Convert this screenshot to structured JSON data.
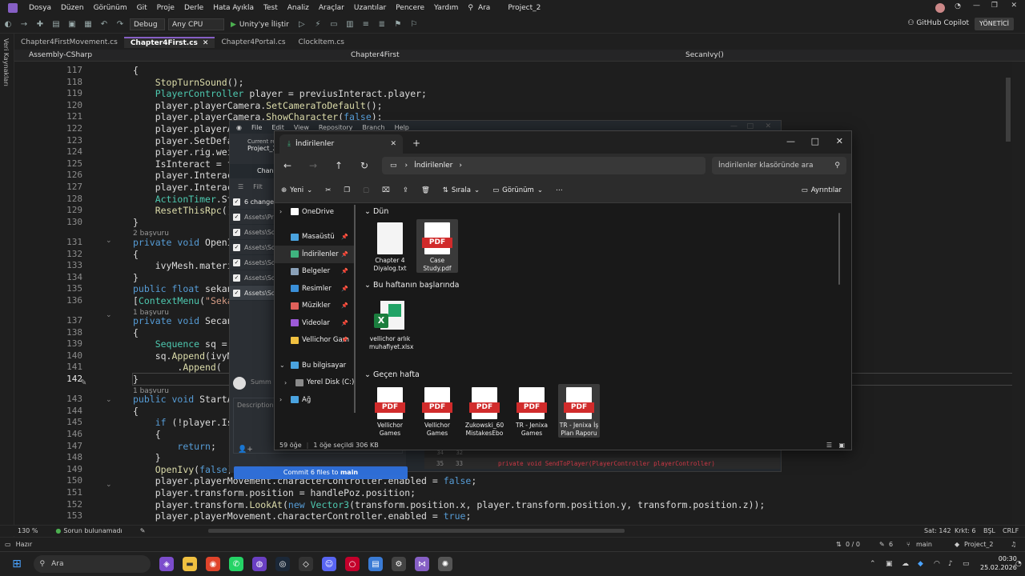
{
  "menu": {
    "items": [
      "Dosya",
      "Düzen",
      "Görünüm",
      "Git",
      "Proje",
      "Derle",
      "Hata Ayıkla",
      "Test",
      "Analiz",
      "Araçlar",
      "Uzantılar",
      "Pencere",
      "Yardım",
      "Ara",
      "Project_2"
    ]
  },
  "toolbar": {
    "config": "Debug",
    "platform": "Any CPU",
    "run_label": "Unity'ye İliştir",
    "copilot": "GitHub Copilot",
    "admin": "YÖNETİCİ"
  },
  "side": {
    "label": "Veri Kaynakları"
  },
  "tabs": [
    {
      "label": "Chapter4FirstMovement.cs",
      "active": false
    },
    {
      "label": "Chapter4First.cs",
      "active": true
    },
    {
      "label": "Chapter4Portal.cs",
      "active": false
    },
    {
      "label": "ClockItem.cs",
      "active": false
    }
  ],
  "navbar": {
    "project": "Assembly-CSharp",
    "class": "Chapter4First",
    "member": "SecanIvy()"
  },
  "code": {
    "line_numbers": [
      "117",
      "118",
      "119",
      "120",
      "121",
      "122",
      "123",
      "124",
      "125",
      "126",
      "127",
      "128",
      "129",
      "130",
      "131",
      "132",
      "133",
      "134",
      "135",
      "136",
      "137",
      "138",
      "139",
      "140",
      "141",
      "142",
      "143",
      "144",
      "145",
      "146",
      "147",
      "148",
      "149",
      "150",
      "151",
      "152",
      "153"
    ],
    "current_line": "142",
    "hint_2": "2 başvuru",
    "hint_1": "1 başvuru",
    "lines": [
      "{",
      "    StopTurnSound();",
      "    PlayerController player = previusInteract.player;",
      "    player.playerCamera.SetCameraToDefault();",
      "    player.playerCamera.ShowCharacter(false);",
      "    player.playerA",
      "    player.SetDefa",
      "    player.rig.wei",
      "    IsInteract = f",
      "    player.Interac",
      "    player.Interac",
      "    ActionTimer.St",
      "    ResetThisRpc()",
      "}",
      "private void OpenI",
      "{",
      "    ivyMesh.materi",
      "}",
      "public float sekan",
      "[ContextMenu(\"Seka",
      "private void Secan",
      "{",
      "    Sequence sq = ",
      "    sq.Append(ivyM",
      "        .Append(",
      "}",
      "public void StartA",
      "{",
      "    if (!player.Is",
      "    {",
      "        return;",
      "    }",
      "    OpenIvy(false);",
      "    player.playerMovement.characterController.enabled = false;",
      "    player.transform.position = handlePoz.position;",
      "    player.transform.LookAt(new Vector3(transform.position.x, player.transform.position.y, transform.position.z));",
      "    player.playerMovement.characterController.enabled = true;"
    ]
  },
  "github": {
    "menu": [
      "File",
      "Edit",
      "View",
      "Repository",
      "Branch",
      "Help"
    ],
    "current_repo_label": "Current re",
    "repo": "Project_2",
    "changes_tab": "Chan",
    "filter": "Filt",
    "changed_count": "6 changed",
    "files": [
      "Assets\\Pr",
      "Assets\\Sc",
      "Assets\\Sc",
      "Assets\\Sc",
      "Assets\\Sc",
      "Assets\\Sc"
    ],
    "summary": "Summ",
    "description": "Description",
    "commit_prefix": "Commit 6 files to ",
    "commit_branch": "main",
    "diff_old": "35",
    "diff_new": "33",
    "diff_prev_old": "34",
    "diff_prev_new": "32",
    "diff_code": "private void SendToPlayer(PlayerController playerController)"
  },
  "explorer": {
    "tab_title": "İndirilenler",
    "address": "İndirilenler",
    "search_placeholder": "İndirilenler klasöründe ara",
    "cmd": {
      "new": "Yeni",
      "sort": "Sırala",
      "view": "Görünüm",
      "details": "Ayrıntılar"
    },
    "nav": [
      {
        "label": "OneDrive",
        "pin": false,
        "color": "#ffffff",
        "caret": "›"
      },
      {
        "label": "Masaüstü",
        "pin": true,
        "color": "#4aa3df",
        "caret": ""
      },
      {
        "label": "İndirilenler",
        "pin": true,
        "color": "#3fb37f",
        "caret": "",
        "selected": true
      },
      {
        "label": "Belgeler",
        "pin": true,
        "color": "#8aa1b8",
        "caret": ""
      },
      {
        "label": "Resimler",
        "pin": true,
        "color": "#3a8fd8",
        "caret": ""
      },
      {
        "label": "Müzikler",
        "pin": true,
        "color": "#e0605a",
        "caret": ""
      },
      {
        "label": "Videolar",
        "pin": true,
        "color": "#9d5ad8",
        "caret": ""
      },
      {
        "label": "Vellichor Gam",
        "pin": true,
        "color": "#f0c040",
        "caret": ""
      },
      {
        "label": "Bu bilgisayar",
        "pin": false,
        "color": "#4aa3df",
        "caret": "⌄"
      },
      {
        "label": "Yerel Disk (C:)",
        "pin": false,
        "color": "#8a8a8a",
        "caret": "›"
      },
      {
        "label": "Ağ",
        "pin": false,
        "color": "#4aa3df",
        "caret": "›"
      }
    ],
    "groups": {
      "yesterday": "Dün",
      "week_start": "Bu haftanın başlarında",
      "last_week": "Geçen hafta"
    },
    "files_yesterday": [
      {
        "name": "Chapter 4 Diyalog.txt",
        "kind": "txt"
      },
      {
        "name": "Case Study.pdf",
        "kind": "pdf",
        "selected": true
      }
    ],
    "files_week": [
      {
        "name": "vellichor arlık muhafiyet.xlsx",
        "kind": "xlsx"
      }
    ],
    "files_lastweek": [
      {
        "name": "Vellichor Games",
        "kind": "pdf"
      },
      {
        "name": "Vellichor Games",
        "kind": "pdf"
      },
      {
        "name": "Zukowski_60 MistakesEbo",
        "kind": "pdf"
      },
      {
        "name": "TR - Jenixa Games",
        "kind": "pdf"
      },
      {
        "name": "TR - Jenixa İş Plan Raporu",
        "kind": "pdf",
        "hover": true
      }
    ],
    "pdf_label": "PDF",
    "status": {
      "count": "59 öğe",
      "selected": "1 öğe seçildi  306 KB"
    }
  },
  "statusbar": {
    "zoom": "130 %",
    "issues": "Sorun bulunamadı",
    "line": "Sat: 142",
    "char": "Krkt: 6",
    "space": "BŞL",
    "eol": "CRLF"
  },
  "appstatus": {
    "ready": "Hazır",
    "updown": "0 / 0",
    "pencil": "6",
    "branch": "main",
    "repo": "Project_2"
  },
  "taskbar": {
    "search": "Ara",
    "time": "00:30",
    "date": "25.02.2026"
  }
}
